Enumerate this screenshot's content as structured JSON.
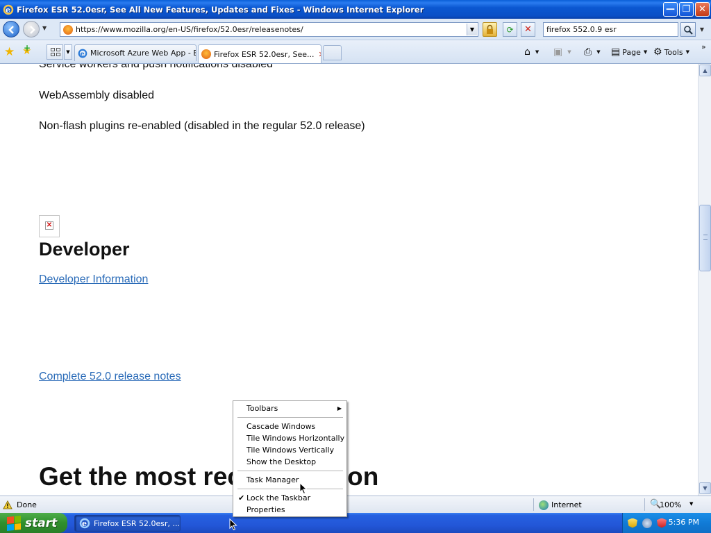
{
  "window": {
    "title": "Firefox ESR 52.0esr, See All New Features, Updates and Fixes - Windows Internet Explorer",
    "buttons": {
      "minimize": "—",
      "restore": "❐",
      "close": "✕"
    }
  },
  "addressbar": {
    "url": "https://www.mozilla.org/en-US/firefox/52.0esr/releasenotes/",
    "search_value": "firefox 552.0.9 esr"
  },
  "tabs": [
    {
      "label": "Microsoft Azure Web App - E...",
      "active": false
    },
    {
      "label": "Firefox ESR 52.0esr, See...",
      "active": true
    }
  ],
  "commandbar": {
    "page_label": "Page",
    "tools_label": "Tools"
  },
  "content": {
    "line_partial": "Service workers and push notifications disabled",
    "line_webassembly": "WebAssembly disabled",
    "line_plugins": "Non-flash plugins re-enabled (disabled in the regular 52.0 release)",
    "developer_heading": "Developer",
    "developer_link": "Developer Information",
    "release_notes_link": "Complete 52.0 release notes",
    "big_heading": "Get the most recent version"
  },
  "context_menu": {
    "items": [
      {
        "label": "Toolbars",
        "submenu": true
      },
      {
        "label": "Cascade Windows"
      },
      {
        "label": "Tile Windows Horizontally"
      },
      {
        "label": "Tile Windows Vertically"
      },
      {
        "label": "Show the Desktop"
      },
      {
        "label": "Task Manager"
      },
      {
        "label": "Lock the Taskbar",
        "checked": true
      },
      {
        "label": "Properties"
      }
    ]
  },
  "statusbar": {
    "status": "Done",
    "zone": "Internet",
    "zoom": "100%"
  },
  "taskbar": {
    "start_label": "start",
    "task_label": "Firefox ESR 52.0esr, ...",
    "clock": "5:36 PM"
  },
  "colors": {
    "link": "#2a6bb8",
    "titlebar": "#0b58d2",
    "taskbar": "#2357d8",
    "start": "#2f8f2c"
  }
}
